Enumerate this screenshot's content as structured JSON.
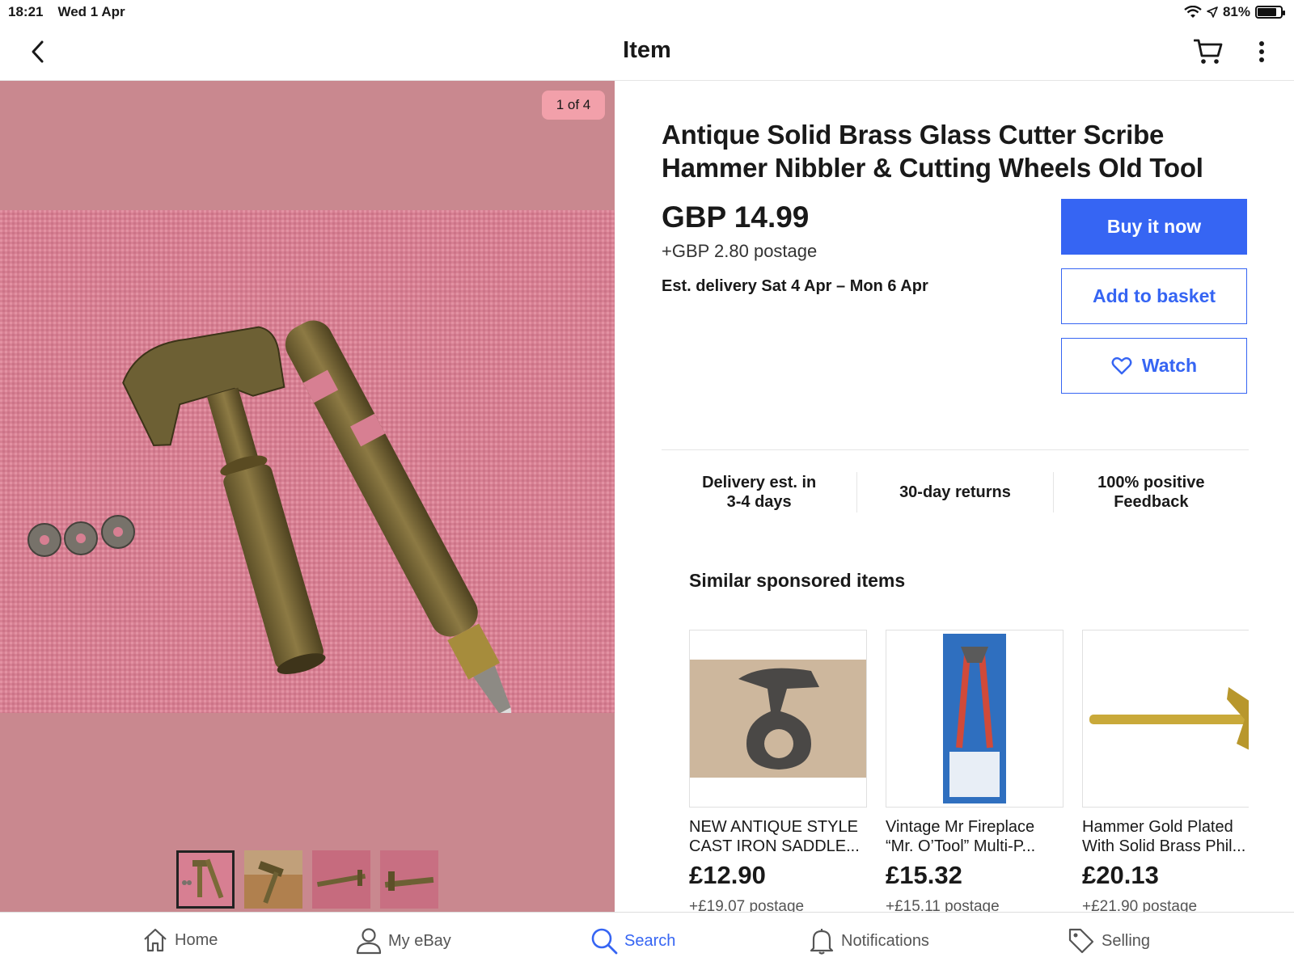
{
  "status_bar": {
    "time": "18:21",
    "date": "Wed 1 Apr",
    "battery": "81%",
    "battery_level": 0.81
  },
  "header": {
    "title": "Item",
    "back_icon": "chevron-left-icon",
    "cart_icon": "cart-icon",
    "more_icon": "more-vertical-icon"
  },
  "gallery": {
    "counter": "1 of 4",
    "background": "#c9888f",
    "thumbnail_count": 4,
    "selected_thumbnail": 1
  },
  "item": {
    "title": "Antique Solid Brass Glass Cutter Scribe Hammer Nibbler & Cutting Wheels Old Tool",
    "price": "GBP 14.99",
    "postage": "+GBP 2.80 postage",
    "delivery_label": "Est. delivery",
    "delivery_dates": "Sat 4 Apr – Mon 6 Apr"
  },
  "actions": {
    "buy_now": "Buy it now",
    "add_to_basket": "Add to basket",
    "watch": "Watch",
    "accent": "#3665f3"
  },
  "badges": [
    {
      "line1": "Delivery est. in",
      "line2": "3-4 days"
    },
    {
      "line1": "30-day returns",
      "line2": ""
    },
    {
      "line1": "100% positive",
      "line2": "Feedback"
    }
  ],
  "similar": {
    "title": "Similar sponsored items",
    "items": [
      {
        "title": "NEW ANTIQUE STYLE CAST IRON SADDLE...",
        "price": "£12.90",
        "postage": "+£19.07 postage"
      },
      {
        "title": "Vintage Mr Fireplace “Mr. O’Tool” Multi-P...",
        "price": "£15.32",
        "postage": "+£15.11 postage"
      },
      {
        "title": "Hammer Gold Plated With Solid Brass Phil...",
        "price": "£20.13",
        "postage": "+£21.90 postage"
      }
    ]
  },
  "tabbar": {
    "items": [
      {
        "label": "Home",
        "icon": "home-icon"
      },
      {
        "label": "My eBay",
        "icon": "person-icon"
      },
      {
        "label": "Search",
        "icon": "search-icon",
        "active": true
      },
      {
        "label": "Notifications",
        "icon": "bell-icon"
      },
      {
        "label": "Selling",
        "icon": "tag-icon"
      }
    ]
  }
}
